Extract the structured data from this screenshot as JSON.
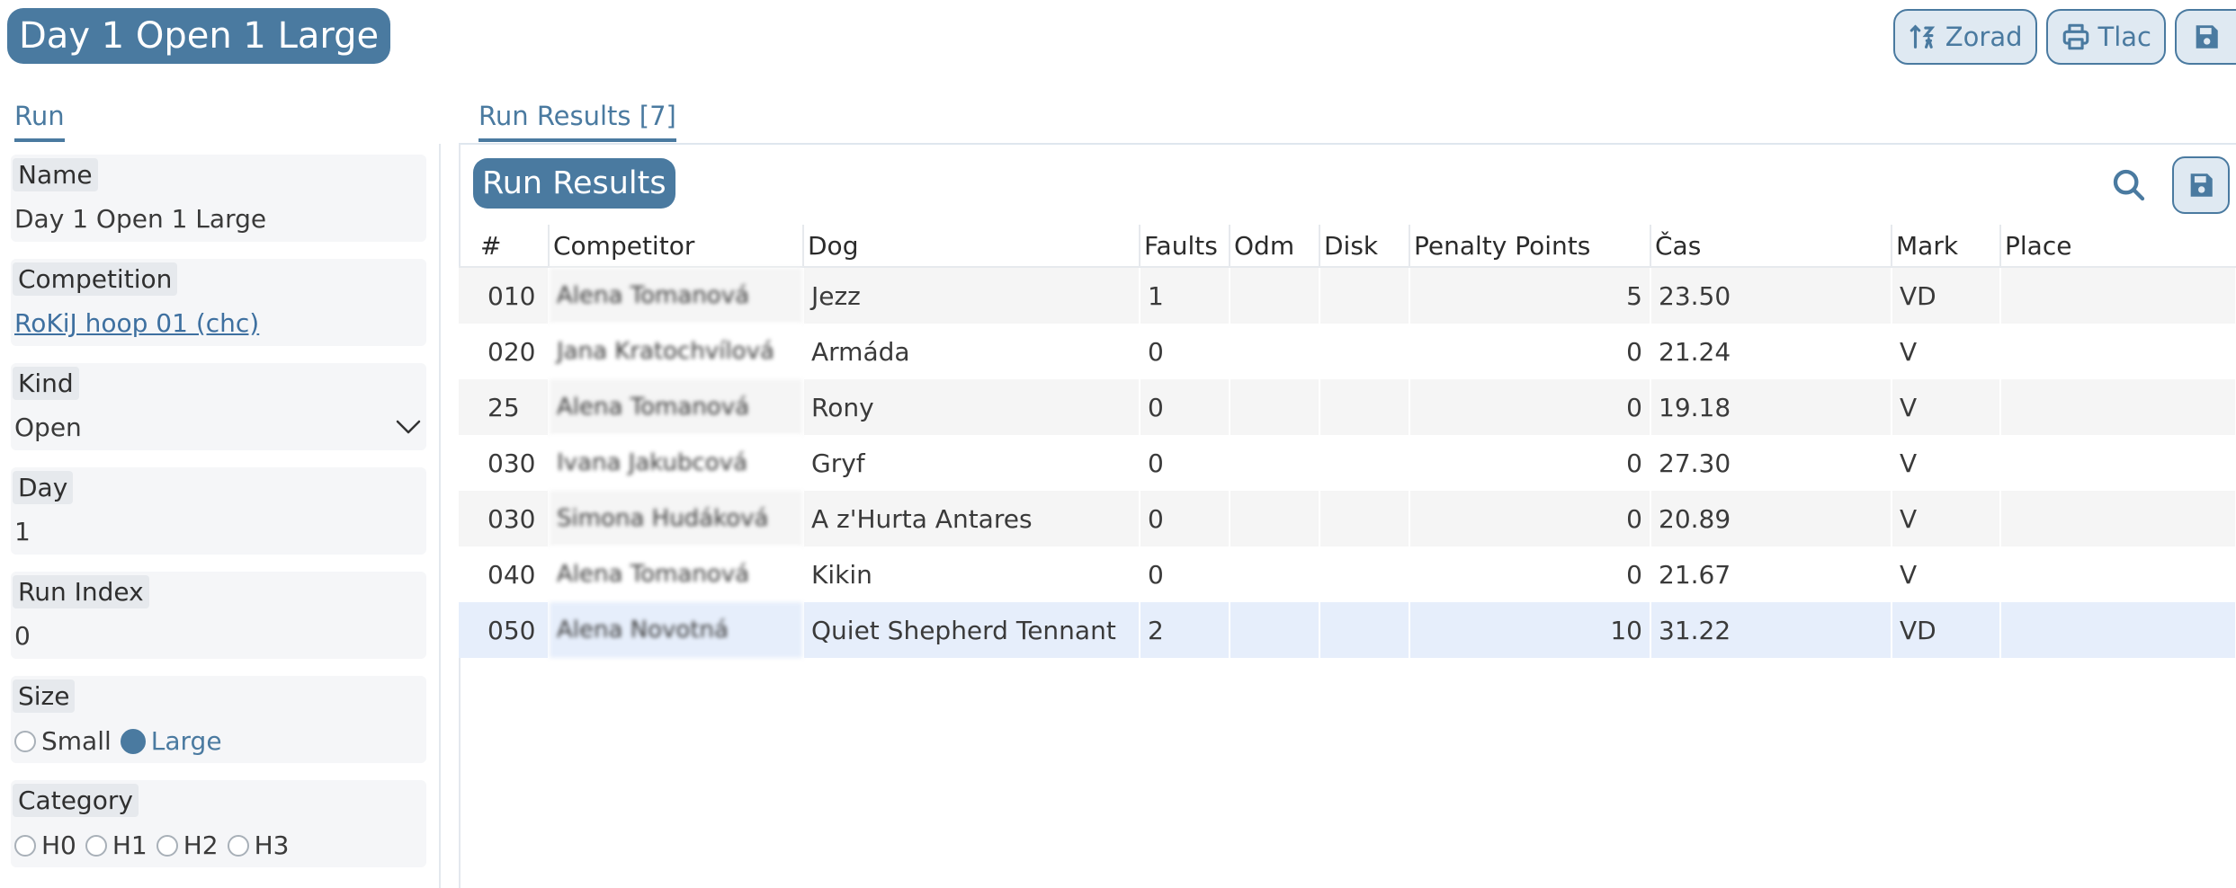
{
  "header": {
    "title": "Day 1 Open 1 Large",
    "actions": {
      "sort_label": "Zorad",
      "print_label": "Tlac"
    }
  },
  "tabs": {
    "run": "Run",
    "results": "Run Results [7]"
  },
  "form": {
    "name": {
      "label": "Name",
      "value": "Day 1 Open 1 Large"
    },
    "competition": {
      "label": "Competition",
      "value": "RoKiJ hoop 01 (chc)"
    },
    "kind": {
      "label": "Kind",
      "value": "Open"
    },
    "day": {
      "label": "Day",
      "value": "1"
    },
    "run_index": {
      "label": "Run Index",
      "value": "0"
    },
    "size": {
      "label": "Size",
      "options": [
        "Small",
        "Large"
      ],
      "selected": "Large"
    },
    "category": {
      "label": "Category",
      "options": [
        "H0",
        "H1",
        "H2",
        "H3"
      ],
      "selected": null
    }
  },
  "results": {
    "title": "Run Results",
    "columns": [
      "#",
      "Competitor",
      "Dog",
      "Faults",
      "Odm",
      "Disk",
      "Penalty Points",
      "Čas",
      "Mark",
      "Place"
    ],
    "rows": [
      {
        "num": "010",
        "competitor": "Alena Tomanová",
        "dog": "Jezz",
        "faults": "1",
        "odm": "",
        "disk": "",
        "penalty": "5",
        "time": "23.50",
        "mark": "VD",
        "place": ""
      },
      {
        "num": "020",
        "competitor": "Jana Kratochvílová",
        "dog": "Armáda",
        "faults": "0",
        "odm": "",
        "disk": "",
        "penalty": "0",
        "time": "21.24",
        "mark": "V",
        "place": ""
      },
      {
        "num": "25",
        "competitor": "Alena Tomanová",
        "dog": "Rony",
        "faults": "0",
        "odm": "",
        "disk": "",
        "penalty": "0",
        "time": "19.18",
        "mark": "V",
        "place": ""
      },
      {
        "num": "030",
        "competitor": "Ivana Jakubcová",
        "dog": "Gryf",
        "faults": "0",
        "odm": "",
        "disk": "",
        "penalty": "0",
        "time": "27.30",
        "mark": "V",
        "place": ""
      },
      {
        "num": "030",
        "competitor": "Simona Hudáková",
        "dog": "A z'Hurta Antares",
        "faults": "0",
        "odm": "",
        "disk": "",
        "penalty": "0",
        "time": "20.89",
        "mark": "V",
        "place": ""
      },
      {
        "num": "040",
        "competitor": "Alena Tomanová",
        "dog": "Kikin",
        "faults": "0",
        "odm": "",
        "disk": "",
        "penalty": "0",
        "time": "21.67",
        "mark": "V",
        "place": ""
      },
      {
        "num": "050",
        "competitor": "Alena Novotná",
        "dog": "Quiet Shepherd Tennant",
        "faults": "2",
        "odm": "",
        "disk": "",
        "penalty": "10",
        "time": "31.22",
        "mark": "VD",
        "place": ""
      }
    ],
    "selected_row": 6
  },
  "colors": {
    "accent": "#4a7aa0",
    "accent_light": "#dfe9f2",
    "row_alt": "#f5f5f5",
    "row_selected": "#e6eefb"
  },
  "icons": {
    "sort": "sort-icon",
    "print": "print-icon",
    "save": "save-icon",
    "search": "search-icon",
    "dropdown": "chevron-down-icon"
  }
}
